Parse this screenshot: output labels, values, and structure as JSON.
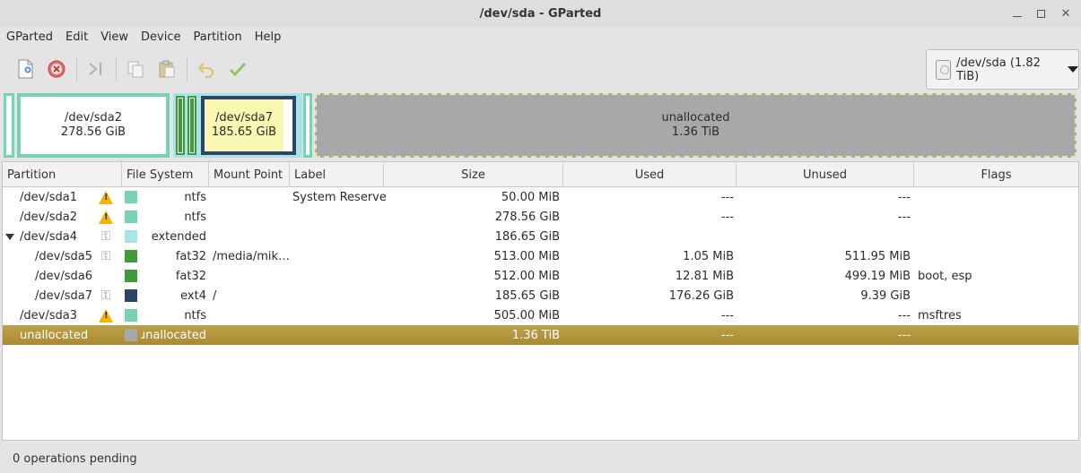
{
  "window": {
    "title": "/dev/sda - GParted"
  },
  "menu": [
    "GParted",
    "Edit",
    "View",
    "Device",
    "Partition",
    "Help"
  ],
  "toolbar": {
    "icons": [
      "new-icon",
      "delete-icon",
      "resize-move-icon",
      "copy-icon",
      "paste-icon",
      "undo-icon",
      "apply-icon"
    ]
  },
  "device": {
    "label": "/dev/sda (1.82 TiB)"
  },
  "map": {
    "sda2_name": "/dev/sda2",
    "sda2_size": "278.56 GiB",
    "sda7_name": "/dev/sda7",
    "sda7_size": "185.65 GiB",
    "unalloc_name": "unallocated",
    "unalloc_size": "1.36 TiB",
    "colors": {
      "ntfs": "#74d4b4",
      "extended": "#a7e3e7",
      "fat32": "#3f9a3a",
      "ext4": "#2c4465",
      "unallocated": "#a8a8a8",
      "used_fill": "#f8f6b0"
    }
  },
  "columns": [
    "Partition",
    "File System",
    "Mount Point",
    "Label",
    "Size",
    "Used",
    "Unused",
    "Flags"
  ],
  "rows": [
    {
      "partition": "/dev/sda1",
      "fs": "ntfs",
      "mount": "",
      "label": "System Reserved",
      "size": "50.00 MiB",
      "used": "---",
      "unused": "---",
      "flags": "",
      "icon": "warning",
      "color": "#74d4b4",
      "indent": 0
    },
    {
      "partition": "/dev/sda2",
      "fs": "ntfs",
      "mount": "",
      "label": "",
      "size": "278.56 GiB",
      "used": "---",
      "unused": "---",
      "flags": "",
      "icon": "warning",
      "color": "#74d4b4",
      "indent": 0
    },
    {
      "partition": "/dev/sda4",
      "fs": "extended",
      "mount": "",
      "label": "",
      "size": "186.65 GiB",
      "used": "",
      "unused": "",
      "flags": "",
      "icon": "key",
      "color": "#a7e3e7",
      "indent": 0,
      "expander": true
    },
    {
      "partition": "/dev/sda5",
      "fs": "fat32",
      "mount": "/media/mik…",
      "label": "",
      "size": "513.00 MiB",
      "used": "1.05 MiB",
      "unused": "511.95 MiB",
      "flags": "",
      "icon": "key",
      "color": "#3f9a3a",
      "indent": 1
    },
    {
      "partition": "/dev/sda6",
      "fs": "fat32",
      "mount": "",
      "label": "",
      "size": "512.00 MiB",
      "used": "12.81 MiB",
      "unused": "499.19 MiB",
      "flags": "boot, esp",
      "icon": "",
      "color": "#3f9a3a",
      "indent": 1
    },
    {
      "partition": "/dev/sda7",
      "fs": "ext4",
      "mount": "/",
      "label": "",
      "size": "185.65 GiB",
      "used": "176.26 GiB",
      "unused": "9.39 GiB",
      "flags": "",
      "icon": "key",
      "color": "#2c4465",
      "indent": 1
    },
    {
      "partition": "/dev/sda3",
      "fs": "ntfs",
      "mount": "",
      "label": "",
      "size": "505.00 MiB",
      "used": "---",
      "unused": "---",
      "flags": "msftres",
      "icon": "warning",
      "color": "#74d4b4",
      "indent": 0
    },
    {
      "partition": "unallocated",
      "fs": "unallocated",
      "mount": "",
      "label": "",
      "size": "1.36 TiB",
      "used": "---",
      "unused": "---",
      "flags": "",
      "icon": "",
      "color": "#a8a8a8",
      "indent": 0,
      "selected": true
    }
  ],
  "status": {
    "text": "0 operations pending"
  }
}
